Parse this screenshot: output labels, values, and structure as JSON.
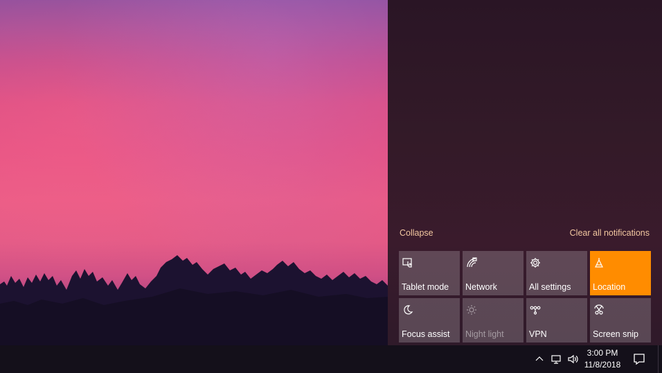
{
  "action_center": {
    "collapse_label": "Collapse",
    "clear_all_label": "Clear all notifications",
    "accent_color": "#ff8c00",
    "quick_actions": [
      {
        "label": "Tablet mode",
        "icon": "tablet-mode-icon",
        "state": "off"
      },
      {
        "label": "Network",
        "icon": "network-icon",
        "state": "off"
      },
      {
        "label": "All settings",
        "icon": "gear-icon",
        "state": "off"
      },
      {
        "label": "Location",
        "icon": "location-icon",
        "state": "on"
      },
      {
        "label": "Focus assist",
        "icon": "moon-icon",
        "state": "off"
      },
      {
        "label": "Night light",
        "icon": "sun-icon",
        "state": "disabled"
      },
      {
        "label": "VPN",
        "icon": "vpn-icon",
        "state": "off"
      },
      {
        "label": "Screen snip",
        "icon": "screen-snip-icon",
        "state": "off"
      }
    ]
  },
  "taskbar": {
    "time": "3:00 PM",
    "date": "11/8/2018",
    "tray_icons": [
      "chevron-up-icon",
      "network-monitor-icon",
      "volume-icon"
    ],
    "notification_icon": "action-center-icon"
  }
}
